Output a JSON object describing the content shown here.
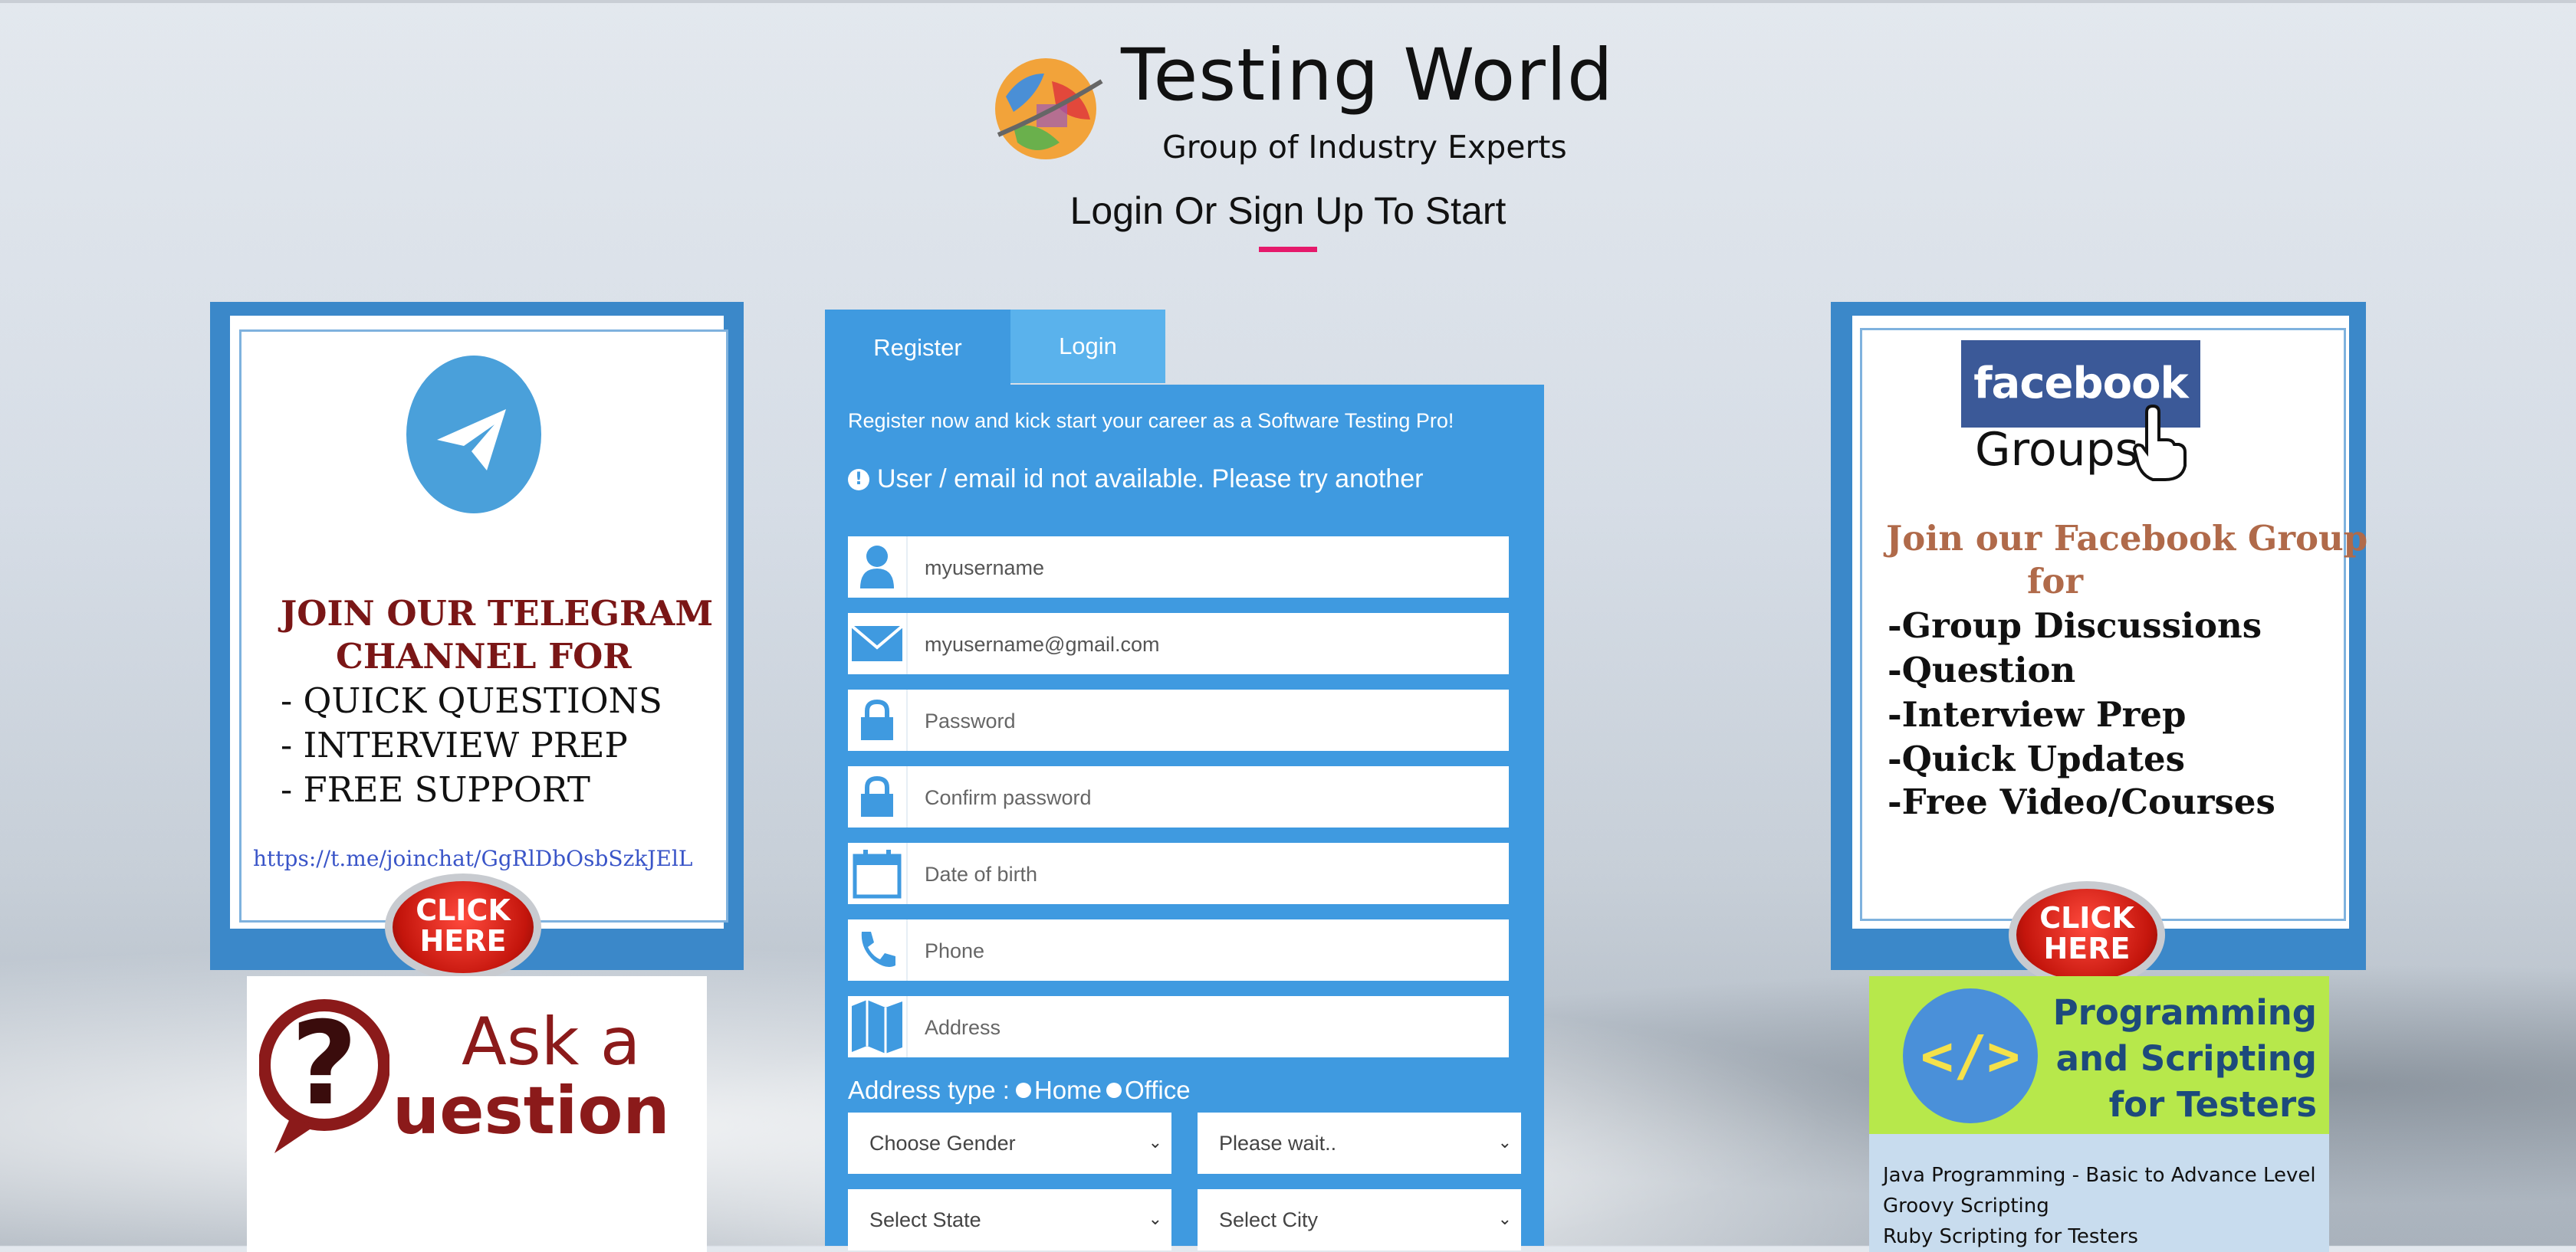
{
  "header": {
    "brand_title": "Testing World",
    "brand_subtitle": "Group of Industry Experts",
    "page_heading": "Login Or Sign Up To Start"
  },
  "left_promo": {
    "telegram_heading": [
      "JOIN OUR TELEGRAM",
      "CHANNEL  FOR"
    ],
    "telegram_items": [
      "- QUICK QUESTIONS",
      "- INTERVIEW PREP",
      "- FREE SUPPORT"
    ],
    "telegram_link": "https://t.me/joinchat/GgRlDbOsbSzkJElL",
    "click_here": "CLICK HERE",
    "ask_line1": "Ask a",
    "ask_line2": "uestion"
  },
  "form": {
    "tabs": {
      "register": "Register",
      "login": "Login"
    },
    "intro": "Register now and kick start your career as a Software Testing Pro!",
    "error": "User / email id not available. Please try another",
    "fields": {
      "username": {
        "value": "myusername",
        "placeholder": "Username"
      },
      "email": {
        "value": "myusername@gmail.com",
        "placeholder": "Email"
      },
      "password": {
        "placeholder": "Password"
      },
      "confirm_password": {
        "placeholder": "Confirm password"
      },
      "dob": {
        "placeholder": "Date of birth"
      },
      "phone": {
        "placeholder": "Phone"
      },
      "address": {
        "placeholder": "Address"
      }
    },
    "address_type_label": "Address type :",
    "address_type_options": [
      "Home",
      "Office"
    ],
    "selects": {
      "gender": "Choose Gender",
      "country": "Please wait..",
      "state": "Select State",
      "city": "Select City"
    }
  },
  "right_promo": {
    "fb_logo": "facebook",
    "fb_groups": "Groups",
    "fb_heading": [
      "Join our Facebook Group",
      "for"
    ],
    "fb_items": [
      "-Group Discussions",
      "-Question",
      "-Interview Prep",
      "-Quick Updates",
      "-Free Video/Courses"
    ],
    "click_here": "CLICK HERE",
    "prog_title": "Programming and Scripting for Testers",
    "prog_list": [
      "Java Programming - Basic to Advance Level",
      "Groovy Scripting",
      "Ruby Scripting for Testers"
    ]
  },
  "colors": {
    "form_blue": "#3f9ae0",
    "accent_pink": "#e5196b",
    "panel_blue": "#3b88c9"
  }
}
